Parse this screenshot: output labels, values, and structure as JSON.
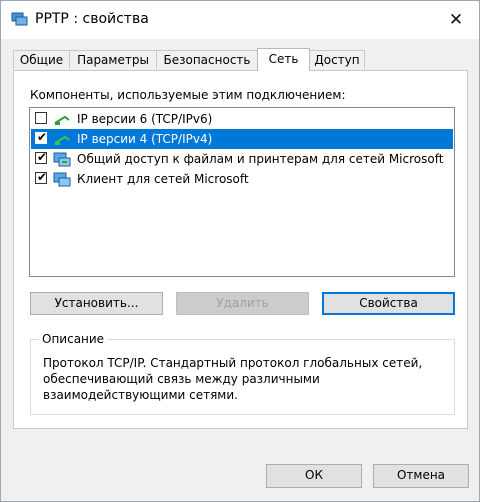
{
  "window": {
    "title": "PPTP : свойства",
    "close_glyph": "✕"
  },
  "tabs": [
    {
      "label": "Общие",
      "active": false
    },
    {
      "label": "Параметры",
      "active": false
    },
    {
      "label": "Безопасность",
      "active": false
    },
    {
      "label": "Сеть",
      "active": true
    },
    {
      "label": "Доступ",
      "active": false
    }
  ],
  "network": {
    "components_label": "Компоненты, используемые этим подключением:",
    "items": [
      {
        "label": "IP версии 6 (TCP/IPv6)",
        "checked": false,
        "selected": false,
        "icon": "network-protocol-icon"
      },
      {
        "label": "IP версии 4 (TCP/IPv4)",
        "checked": true,
        "selected": true,
        "icon": "network-protocol-icon"
      },
      {
        "label": "Общий доступ к файлам и принтерам для сетей Microsoft",
        "checked": true,
        "selected": false,
        "icon": "network-service-icon"
      },
      {
        "label": "Клиент для сетей Microsoft",
        "checked": true,
        "selected": false,
        "icon": "network-client-icon"
      }
    ],
    "check_glyph": "✔",
    "install_label": "Установить...",
    "remove_label": "Удалить",
    "properties_label": "Свойства",
    "description_title": "Описание",
    "description_text": "Протокол TCP/IP. Стандартный протокол глобальных сетей, обеспечивающий связь между различными взаимодействующими сетями."
  },
  "footer": {
    "ok_label": "ОК",
    "cancel_label": "Отмена"
  },
  "colors": {
    "selection": "#0078d7",
    "window_bg": "#f0f0f0"
  }
}
